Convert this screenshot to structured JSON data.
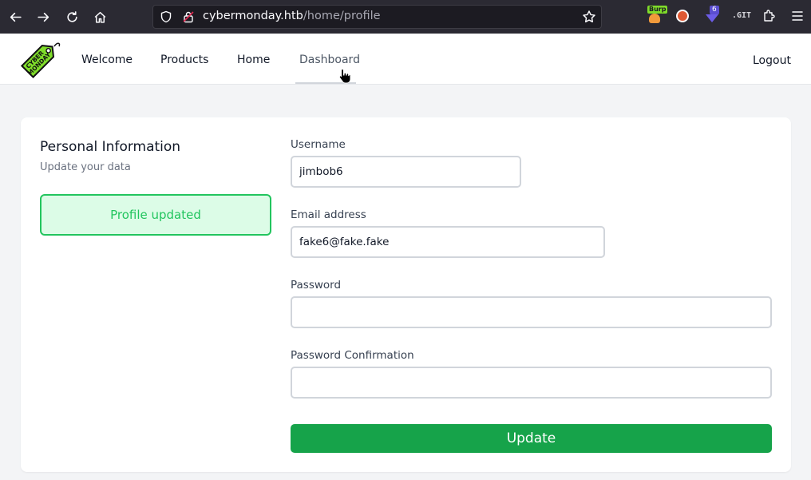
{
  "browser": {
    "url_host": "cybermonday.htb",
    "url_path": "/home/profile",
    "extensions": [
      {
        "name": "burp-extension-icon",
        "label": "Burp"
      },
      {
        "name": "duckduckgo-extension-icon"
      },
      {
        "name": "ublock-extension-icon",
        "badge": "6"
      },
      {
        "name": "git-extension-icon",
        "label": ".GIT"
      }
    ]
  },
  "site": {
    "logo_text": "CYBER MONDAY",
    "nav": {
      "welcome": "Welcome",
      "products": "Products",
      "home": "Home",
      "dashboard": "Dashboard",
      "logout": "Logout"
    }
  },
  "profile": {
    "title": "Personal Information",
    "subtitle": "Update your data",
    "alert": "Profile updated",
    "fields": {
      "username": {
        "label": "Username",
        "value": "jimbob6"
      },
      "email": {
        "label": "Email address",
        "value": "fake6@fake.fake"
      },
      "password": {
        "label": "Password",
        "value": ""
      },
      "password_confirmation": {
        "label": "Password Confirmation",
        "value": ""
      }
    },
    "submit": "Update"
  },
  "colors": {
    "accent_green": "#16a34a",
    "alert_bg": "#dcfce7",
    "alert_border": "#22c55e",
    "browser_chrome": "#2b2a33",
    "logo_green": "#7fdc2a"
  }
}
